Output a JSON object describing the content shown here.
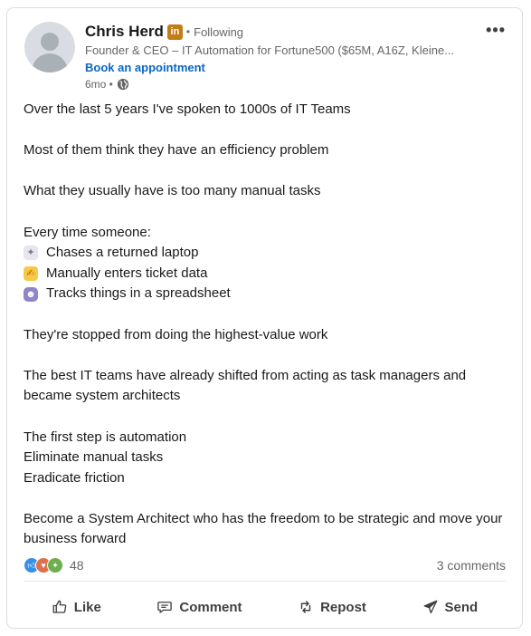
{
  "post": {
    "author": {
      "name": "Chris Herd",
      "badge": "in",
      "separator": "•",
      "follow_status": "Following",
      "headline": "Founder & CEO – IT Automation for Fortune500 ($65M, A16Z, Kleine...",
      "cta": "Book an appointment",
      "age": "6mo •"
    },
    "body": {
      "p1": "Over the last 5 years I've spoken to 1000s of IT Teams",
      "p2": "Most of them think they have an efficiency problem",
      "p3": "What they usually have is too many manual tasks",
      "p4": "Every time someone:",
      "list": [
        {
          "icon": "laptop-icon",
          "text": "Chases a returned laptop"
        },
        {
          "icon": "writing-hand-icon",
          "text": "Manually enters ticket data"
        },
        {
          "icon": "robot-icon",
          "text": "Tracks things in a spreadsheet"
        }
      ],
      "p5": "They're stopped from doing the highest-value work",
      "p6": "The best IT teams have already shifted from acting as task managers and became system architects",
      "p7a": "The first step is automation",
      "p7b": "Eliminate manual tasks",
      "p7c": "Eradicate friction",
      "p8": "Become a System Architect who has the freedom to be strategic and move your business forward"
    },
    "social": {
      "reaction_icons": [
        "like-icon",
        "love-icon",
        "celebrate-icon"
      ],
      "reaction_count": "48",
      "comments": "3 comments"
    },
    "actions": {
      "like": "Like",
      "comment": "Comment",
      "repost": "Repost",
      "send": "Send"
    },
    "colors": {
      "link_blue": "#0a66c2",
      "badge_gold": "#c37d16",
      "muted_text": "#666666"
    }
  }
}
